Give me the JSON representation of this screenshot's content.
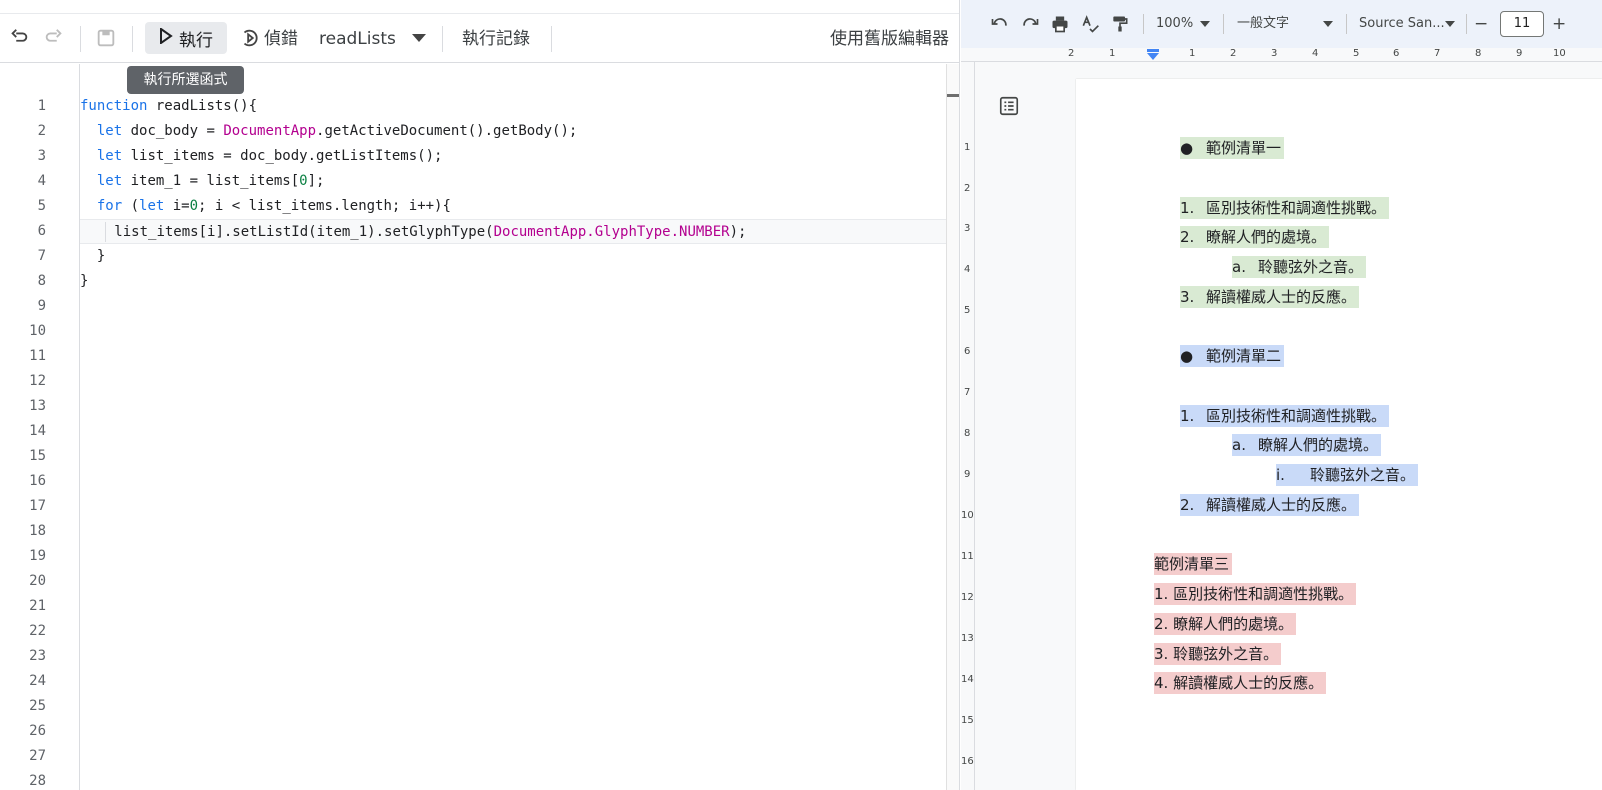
{
  "editor": {
    "toolbar": {
      "run_label": "執行",
      "debug_label": "偵錯",
      "function_select": "readLists",
      "execution_log_label": "執行記錄",
      "legacy_editor_label": "使用舊版編輯器",
      "tooltip": "執行所選函式"
    },
    "line_numbers": [
      "1",
      "2",
      "3",
      "4",
      "5",
      "6",
      "7",
      "8",
      "9",
      "10",
      "11",
      "12",
      "13",
      "14",
      "15",
      "16",
      "17",
      "18",
      "19",
      "20",
      "21",
      "22",
      "23",
      "24",
      "25",
      "26",
      "27",
      "28"
    ],
    "code": {
      "l1_kw": "function",
      "l1_rest": " readLists(){",
      "l2_kw": "let",
      "l2_a": " doc_body = ",
      "l2_cls": "DocumentApp",
      "l2_b": ".getActiveDocument().getBody();",
      "l3_kw": "let",
      "l3_rest": " list_items = doc_body.getListItems();",
      "l4_kw": "let",
      "l4_a": " item_1 = list_items[",
      "l4_num": "0",
      "l4_b": "];",
      "l5_kw1": "for",
      "l5_a": " (",
      "l5_kw2": "let",
      "l5_b": " i=",
      "l5_num": "0",
      "l5_c": "; i < list_items.length; i++){",
      "l6_a": "list_items[i].setListId(item_1).setGlyphType(",
      "l6_cls": "DocumentApp.GlyphType.NUMBER",
      "l6_b": ");",
      "l7": "}",
      "l8": "}"
    }
  },
  "docs": {
    "toolbar": {
      "zoom": "100%",
      "style": "一般文字",
      "font": "Source San...",
      "font_size": "11",
      "minus": "−",
      "plus": "+"
    },
    "hruler_labels": [
      "2",
      "1",
      "1",
      "2",
      "3",
      "4",
      "5",
      "6",
      "7",
      "8",
      "9",
      "10"
    ],
    "vruler_labels": [
      "1",
      "2",
      "3",
      "4",
      "5",
      "6",
      "7",
      "8",
      "9",
      "10",
      "11",
      "12",
      "13",
      "14",
      "15",
      "16"
    ],
    "list1": {
      "title_marker": "●",
      "title": "範例清單一",
      "items": [
        {
          "marker": "1.",
          "text": "區別技術性和調適性挑戰。"
        },
        {
          "marker": "2.",
          "text": "瞭解人們的處境。"
        },
        {
          "marker": "a.",
          "text": "聆聽弦外之音。"
        },
        {
          "marker": "3.",
          "text": "解讀權威人士的反應。"
        }
      ]
    },
    "list2": {
      "title_marker": "●",
      "title": "範例清單二",
      "items": [
        {
          "marker": "1.",
          "text": "區別技術性和調適性挑戰。"
        },
        {
          "marker": "a.",
          "text": "瞭解人們的處境。"
        },
        {
          "marker": "i.",
          "text": "聆聽弦外之音。"
        },
        {
          "marker": "2.",
          "text": "解讀權威人士的反應。"
        }
      ]
    },
    "list3": {
      "title": "範例清單三",
      "items": [
        "1. 區別技術性和調適性挑戰。",
        "2. 瞭解人們的處境。",
        "3. 聆聽弦外之音。",
        "4. 解讀權威人士的反應。"
      ]
    }
  },
  "colors": {
    "list1_highlight": "#d9ead3",
    "list2_highlight": "#c9daf8",
    "list3_highlight": "#f4cccc",
    "keyword": "#1a73e8",
    "class": "#b3008f",
    "number": "#0b8043"
  },
  "icons": [
    "undo-icon",
    "redo-icon",
    "save-icon",
    "play-icon",
    "debug-icon",
    "dropdown-icon",
    "print-icon",
    "spellcheck-icon",
    "paint-format-icon",
    "outline-icon"
  ]
}
